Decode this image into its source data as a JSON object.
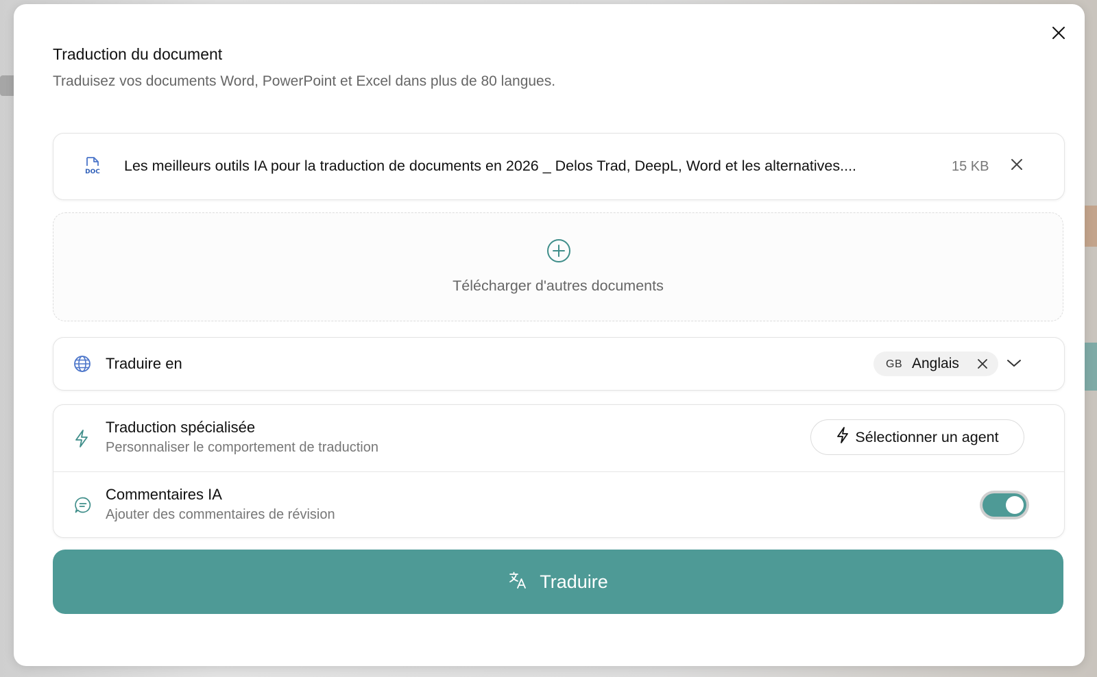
{
  "dialog": {
    "title": "Traduction du document",
    "subtitle": "Traduisez vos documents Word, PowerPoint et Excel dans plus de 80 langues."
  },
  "file": {
    "type_label": "DOC",
    "name": "Les meilleurs outils IA pour la traduction de documents en 2026 _ Delos Trad, DeepL, Word et les alternatives....",
    "size": "15 KB"
  },
  "upload": {
    "label": "Télécharger d'autres documents"
  },
  "target_language": {
    "label": "Traduire en",
    "selected": {
      "code": "GB",
      "name": "Anglais"
    }
  },
  "options": {
    "specialized": {
      "title": "Traduction spécialisée",
      "description": "Personnaliser le comportement de traduction",
      "button_label": "Sélectionner un agent"
    },
    "ai_comments": {
      "title": "Commentaires IA",
      "description": "Ajouter des commentaires de révision",
      "enabled": true
    }
  },
  "primary_action": {
    "label": "Traduire"
  },
  "colors": {
    "accent": "#4e9a96",
    "icon_blue": "#4a74c9",
    "icon_teal": "#3f8e8a"
  },
  "icons": {
    "close": "close-icon",
    "file": "doc-file-icon",
    "upload": "plus-circle-icon",
    "globe": "globe-icon",
    "bolt": "bolt-icon",
    "comment": "comment-icon",
    "chevron": "chevron-down-icon",
    "translate": "translate-icon"
  }
}
